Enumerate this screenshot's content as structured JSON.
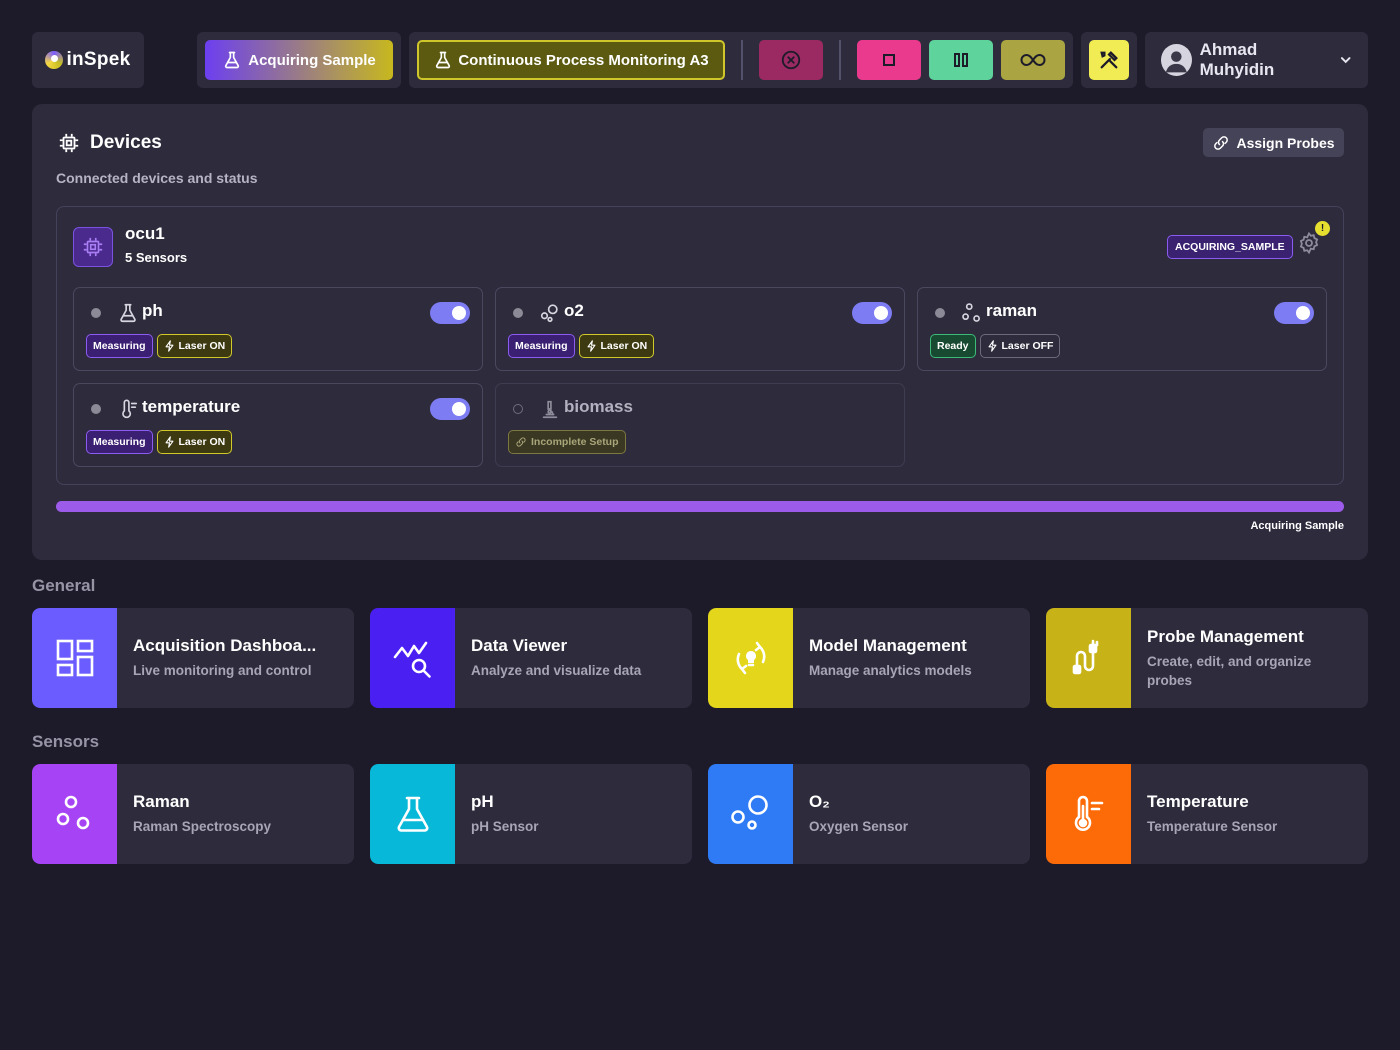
{
  "brand": {
    "name": "inSpek"
  },
  "topbar": {
    "status_label": "Acquiring Sample",
    "process_label": "Continuous Process Monitoring A3",
    "user_name": "Ahmad Muhyidin"
  },
  "devices": {
    "title": "Devices",
    "subtitle": "Connected devices and status",
    "assign_label": "Assign Probes",
    "device": {
      "name": "ocu1",
      "count_label": "5 Sensors",
      "state": "ACQUIRING_SAMPLE",
      "warning": "!"
    },
    "sensors": [
      {
        "name": "ph",
        "icon": "flask-icon",
        "enabled": true,
        "badges": [
          "Measuring",
          "Laser ON"
        ]
      },
      {
        "name": "o2",
        "icon": "bubbles-icon",
        "enabled": true,
        "badges": [
          "Measuring",
          "Laser ON"
        ]
      },
      {
        "name": "raman",
        "icon": "raman-icon",
        "enabled": true,
        "badges": [
          "Ready",
          "Laser OFF"
        ]
      },
      {
        "name": "temperature",
        "icon": "thermometer-icon",
        "enabled": true,
        "badges": [
          "Measuring",
          "Laser ON"
        ]
      },
      {
        "name": "biomass",
        "icon": "microscope-icon",
        "enabled": false,
        "badges": [
          "Incomplete Setup"
        ]
      }
    ],
    "progress": {
      "value": 1.0,
      "label": "Acquiring Sample"
    }
  },
  "general": {
    "heading": "General",
    "tiles": [
      {
        "title": "Acquisition Dashboa...",
        "desc": "Live monitoring and control",
        "icon": "dashboard-icon",
        "color": "#6b5cff"
      },
      {
        "title": "Data Viewer",
        "desc": "Analyze and visualize data",
        "icon": "chart-search-icon",
        "color": "#4a1ff2"
      },
      {
        "title": "Model Management",
        "desc": "Manage analytics models",
        "icon": "model-refresh-icon",
        "color": "#e4d61a"
      },
      {
        "title": "Probe Management",
        "desc": "Create, edit, and organize probes",
        "icon": "probe-icon",
        "color": "#c7b317"
      }
    ]
  },
  "sensors_section": {
    "heading": "Sensors",
    "tiles": [
      {
        "title": "Raman",
        "desc": "Raman Spectroscopy",
        "icon": "raman-icon",
        "color": "#a644f5"
      },
      {
        "title": "pH",
        "desc": "pH Sensor",
        "icon": "flask-icon",
        "color": "#08b8d8"
      },
      {
        "title": "O₂",
        "desc": "Oxygen Sensor",
        "icon": "bubbles-icon",
        "color": "#2f7bf6"
      },
      {
        "title": "Temperature",
        "desc": "Temperature Sensor",
        "icon": "thermometer-icon",
        "color": "#fd6a08"
      }
    ]
  },
  "colors": {
    "background": "#1d1b2a",
    "panel": "#2e2c3c",
    "accent_purple": "#9c5be8",
    "accent_yellow": "#e6df30"
  }
}
